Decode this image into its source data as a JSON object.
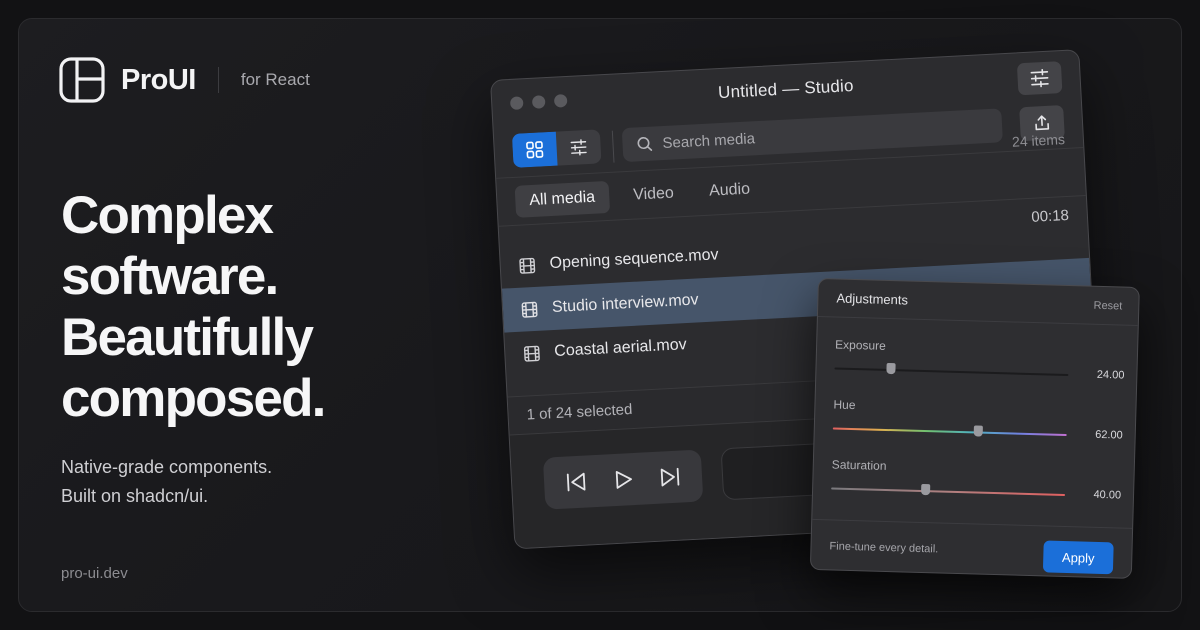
{
  "brand": {
    "name": "ProUI",
    "tag": "for React"
  },
  "headline": [
    "Complex",
    "software.",
    "Beautifully",
    "composed."
  ],
  "subtitle": [
    "Native-grade components.",
    "Built on shadcn/ui."
  ],
  "url": "pro-ui.dev",
  "window": {
    "title": "Untitled — Studio",
    "search_placeholder": "Search media",
    "tabs": [
      "All media",
      "Video",
      "Audio"
    ],
    "active_tab": "All media",
    "item_count": "24 items",
    "duration": "00:18",
    "files": [
      "Opening sequence.mov",
      "Studio interview.mov",
      "Coastal aerial.mov"
    ],
    "selected_file": "Studio interview.mov",
    "status": "1 of 24 selected"
  },
  "adjustments": {
    "title": "Adjustments",
    "reset_label": "Reset",
    "controls": [
      {
        "label": "Exposure",
        "value": "24.00",
        "level": 0.24
      },
      {
        "label": "Hue",
        "value": "62.00",
        "level": 0.62
      },
      {
        "label": "Saturation",
        "value": "40.00",
        "level": 0.4
      }
    ],
    "footer_note": "Fine-tune every detail.",
    "apply_label": "Apply"
  },
  "colors": {
    "accent": "#1b6fd9",
    "selection": "#46556a"
  },
  "icons": {
    "logo": "layout-panels-icon",
    "sliders": "sliders-icon",
    "grid": "grid-icon",
    "search": "search-icon",
    "share": "share-icon",
    "film": "film-icon",
    "prev": "skip-back-icon",
    "play": "play-icon",
    "next": "skip-forward-icon"
  }
}
